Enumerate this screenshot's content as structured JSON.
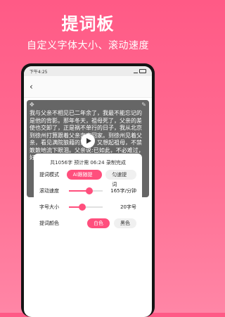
{
  "promo": {
    "title": "提词板",
    "subtitle": "自定义字体大小、滚动速度"
  },
  "status": {
    "time": "下午4:25"
  },
  "teleprompter": {
    "text": "我与父亲不相见已二年余了，我最不能忘记的是他的背影。那年冬天，祖母死了，父亲的差使也交卸了，正是祸不单行的日子，我从北京到徐州打算跟着父亲奔丧回家。到徐州见着父亲，看见满院狼藉的东西，又想起祖母，不禁簌簌地流下眼泪。父亲说:已如此，不必难过，好在天无绝人之路!"
  },
  "controls": {
    "summary": "共1056字  预计需 06:24 录制完成",
    "mode_label": "提词模式",
    "mode_options": [
      "AI跟随提词",
      "匀速提词"
    ],
    "speed_label": "滚动速度",
    "speed_value": "165字/分钟",
    "speed_fraction": 0.6,
    "size_label": "字号大小",
    "size_value": "20字号",
    "size_fraction": 0.4,
    "color_label": "提词颜色",
    "color_options": [
      "白色",
      "黑色"
    ]
  },
  "colors": {
    "accent": "#ff4f7d",
    "background": "#ff6e93"
  }
}
